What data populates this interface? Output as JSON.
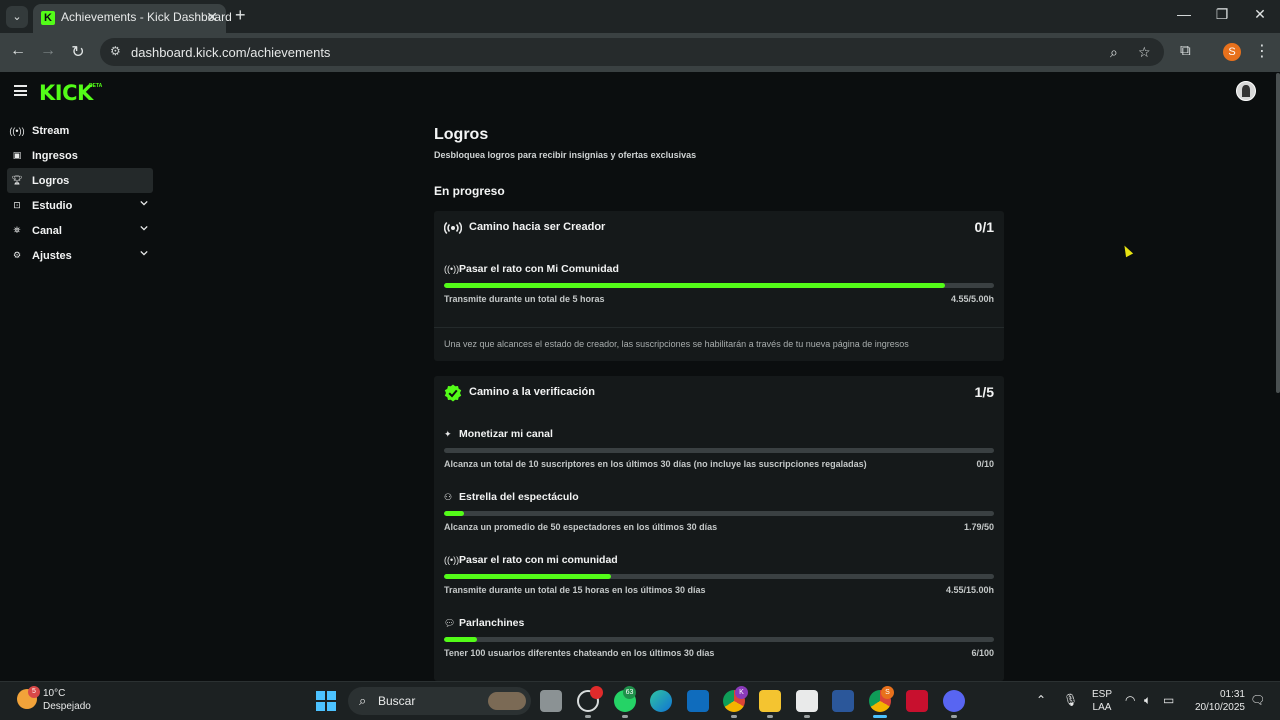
{
  "browser": {
    "tab_title": "Achievements - Kick Dashboard",
    "url": "dashboard.kick.com/achievements",
    "profile_initial": "S"
  },
  "app": {
    "logo": "KICK",
    "logo_badge": "BETA"
  },
  "sidebar": {
    "items": [
      {
        "label": "Stream",
        "icon": "broadcast-icon",
        "active": false,
        "expandable": false
      },
      {
        "label": "Ingresos",
        "icon": "wallet-icon",
        "active": false,
        "expandable": false
      },
      {
        "label": "Logros",
        "icon": "trophy-icon",
        "active": true,
        "expandable": false
      },
      {
        "label": "Estudio",
        "icon": "studio-icon",
        "active": false,
        "expandable": true
      },
      {
        "label": "Canal",
        "icon": "channel-icon",
        "active": false,
        "expandable": true
      },
      {
        "label": "Ajustes",
        "icon": "gear-icon",
        "active": false,
        "expandable": true
      }
    ]
  },
  "main": {
    "title": "Logros",
    "subtitle": "Desbloquea logros para recibir insignias y ofertas exclusivas",
    "section_title": "En progreso",
    "cards": [
      {
        "title": "Camino hacia ser Creador",
        "count": "0/1",
        "tasks": [
          {
            "title": "Pasar el rato con Mi Comunidad",
            "icon": "broadcast-icon",
            "description": "Transmite durante un total de 5 horas",
            "progress_text": "4.55/5.00h",
            "progress": 0.91
          }
        ],
        "note": "Una vez que alcances el estado de creador, las suscripciones se habilitarán a través de tu nueva página de ingresos"
      },
      {
        "title": "Camino a la verificación",
        "count": "1/5",
        "tasks": [
          {
            "title": "Monetizar mi canal",
            "icon": "sparkle-icon",
            "description": "Alcanza un total de 10 suscriptores en los últimos 30 días (no incluye las suscripciones regaladas)",
            "progress_text": "0/10",
            "progress": 0.0
          },
          {
            "title": "Estrella del espectáculo",
            "icon": "viewers-icon",
            "description": "Alcanza un promedio de 50 espectadores en los últimos 30 días",
            "progress_text": "1.79/50",
            "progress": 0.036
          },
          {
            "title": "Pasar el rato con mi comunidad",
            "icon": "broadcast-icon",
            "description": "Transmite durante un total de 15 horas en los últimos 30 días",
            "progress_text": "4.55/15.00h",
            "progress": 0.303
          },
          {
            "title": "Parlanchines",
            "icon": "chat-icon",
            "description": "Tener 100 usuarios diferentes chateando en los últimos 30 días",
            "progress_text": "6/100",
            "progress": 0.06
          }
        ]
      }
    ]
  },
  "taskbar": {
    "temperature": "10°C",
    "weather": "Despejado",
    "weather_badge": "5",
    "search_label": "Buscar",
    "whatsapp_badge": "63",
    "chrome_badge": "K",
    "chrome2_badge": "S",
    "lang_line1": "ESP",
    "lang_line2": "LAA",
    "time": "01:31",
    "date": "20/10/2025"
  },
  "colors": {
    "accent": "#53fc18",
    "background": "#0b0e0f",
    "card": "#15191a"
  }
}
